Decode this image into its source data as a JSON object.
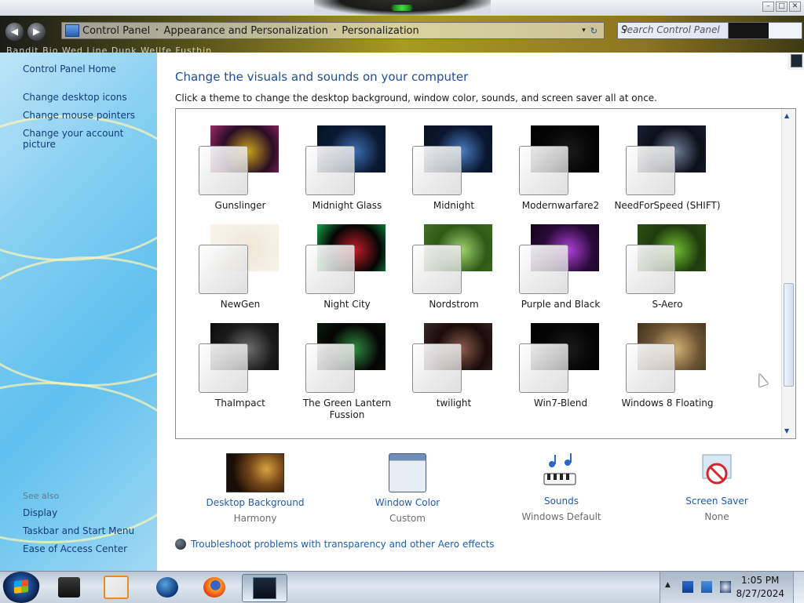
{
  "window": {
    "minimize": "–",
    "maximize": "□",
    "close": "✕"
  },
  "address": {
    "back": "◀",
    "forward": "▶",
    "crumbs": [
      "Control Panel",
      "Appearance and Personalization",
      "Personalization"
    ],
    "separator": "•",
    "dropdown": "▾",
    "refresh": "↻",
    "strip_text": "Bandit Bio Wed Line Dunk Wellfe Fusthin"
  },
  "search": {
    "placeholder": "Search Control Panel",
    "icon": "search-icon"
  },
  "sidebar": {
    "home": "Control Panel Home",
    "links": [
      "Change desktop icons",
      "Change mouse pointers",
      "Change your account picture"
    ],
    "see_also_title": "See also",
    "see_also": [
      "Display",
      "Taskbar and Start Menu",
      "Ease of Access Center"
    ]
  },
  "main": {
    "heading": "Change the visuals and sounds on your computer",
    "subheading": "Click a theme to change the desktop background, window color, sounds, and screen saver all at once."
  },
  "themes": [
    {
      "label": "Gunslinger",
      "colors": [
        "#2a0d24",
        "#c8a21b",
        "#9b2a6b"
      ]
    },
    {
      "label": "Midnight Glass",
      "colors": [
        "#0b1a33",
        "#3c6eb0",
        "#071022"
      ]
    },
    {
      "label": "Midnight",
      "colors": [
        "#0a1730",
        "#4a7ec2",
        "#081020"
      ]
    },
    {
      "label": "Modernwarfare2",
      "colors": [
        "#050505",
        "#1a1a1a",
        "#000000"
      ]
    },
    {
      "label": "NeedForSpeed (SHIFT)",
      "colors": [
        "#0d0f18",
        "#6f7f9a",
        "#1a2234"
      ]
    },
    {
      "label": "NewGen",
      "colors": [
        "#f5f0e6",
        "#efe6d4",
        "#f8f4ec"
      ]
    },
    {
      "label": "Night City",
      "colors": [
        "#050505",
        "#c21d28",
        "#16a34a"
      ]
    },
    {
      "label": "Nordstrom",
      "colors": [
        "#2d5a18",
        "#9fd36a",
        "#476f25"
      ]
    },
    {
      "label": "Purple and Black",
      "colors": [
        "#2a0a3a",
        "#b040d8",
        "#120418"
      ]
    },
    {
      "label": "S-Aero",
      "colors": [
        "#1f3b0d",
        "#6fbf2f",
        "#2b5214"
      ]
    },
    {
      "label": "ThaImpact",
      "colors": [
        "#1b1b1b",
        "#6d6d6d",
        "#0b0b0b"
      ]
    },
    {
      "label": "The Green Lantern Fussion",
      "colors": [
        "#050505",
        "#2f8a3e",
        "#0a1a0d"
      ]
    },
    {
      "label": "twilight",
      "colors": [
        "#1a0a0a",
        "#8a5a4a",
        "#3a2a2a"
      ]
    },
    {
      "label": "Win7-Blend",
      "colors": [
        "#050505",
        "#1a1a1a",
        "#000000"
      ]
    },
    {
      "label": "Windows 8 Floating",
      "colors": [
        "#6b5232",
        "#d6b47a",
        "#3e2f1e"
      ]
    }
  ],
  "tools": [
    {
      "name": "Desktop Background",
      "value": "Harmony",
      "icon": "desktop-background-icon"
    },
    {
      "name": "Window Color",
      "value": "Custom",
      "icon": "window-color-icon"
    },
    {
      "name": "Sounds",
      "value": "Windows Default",
      "icon": "sounds-icon"
    },
    {
      "name": "Screen Saver",
      "value": "None",
      "icon": "screen-saver-icon"
    }
  ],
  "troubleshoot": "Troubleshoot problems with transparency and other Aero effects",
  "taskbar": {
    "items": [
      "file-manager-icon",
      "media-player-icon",
      "browser-globe-icon",
      "firefox-icon",
      "personalization-window-icon"
    ],
    "tray_caret": "▲",
    "time": "1:05 PM",
    "date": "8/27/2024"
  }
}
